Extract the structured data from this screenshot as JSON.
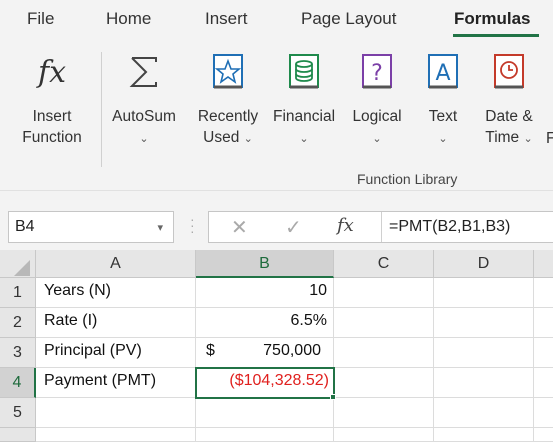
{
  "menu": {
    "tabs": [
      {
        "label": "File"
      },
      {
        "label": "Home"
      },
      {
        "label": "Insert"
      },
      {
        "label": "Page Layout"
      },
      {
        "label": "Formulas"
      }
    ],
    "active_tab": "Formulas",
    "accent_color": "#217346"
  },
  "ribbon": {
    "insert_function": {
      "line1": "Insert",
      "line2": "Function",
      "icon": "fx-icon"
    },
    "autosum": {
      "line1": "AutoSum",
      "icon": "sigma-icon"
    },
    "recently_used": {
      "line1": "Recently",
      "line2": "Used",
      "icon": "star-book-icon"
    },
    "financial": {
      "line1": "Financial",
      "icon": "money-book-icon"
    },
    "logical": {
      "line1": "Logical",
      "icon": "question-book-icon"
    },
    "text": {
      "line1": "Text",
      "icon": "text-book-icon"
    },
    "date_time": {
      "line1": "Date &",
      "line2": "Time",
      "icon": "clock-book-icon"
    },
    "truncated": "F",
    "group_label": "Function Library"
  },
  "formula_bar": {
    "name_box": "B4",
    "cancel_glyph": "✕",
    "enter_glyph": "✓",
    "fx_label": "fx",
    "formula": "=PMT(B2,B1,B3)"
  },
  "sheet": {
    "columns": [
      "A",
      "B",
      "C",
      "D"
    ],
    "rows": [
      "1",
      "2",
      "3",
      "4",
      "5"
    ],
    "selected_cell": "B4",
    "cells": {
      "A1": "Years (N)",
      "A2": "Rate (I)",
      "A3": "Principal (PV)",
      "A4": "Payment (PMT)",
      "B1": "10",
      "B2": "6.5%",
      "B3_symbol": "$",
      "B3_value": "750,000",
      "B4": "($104,328.52)"
    },
    "negative_color": "#e0201e"
  }
}
